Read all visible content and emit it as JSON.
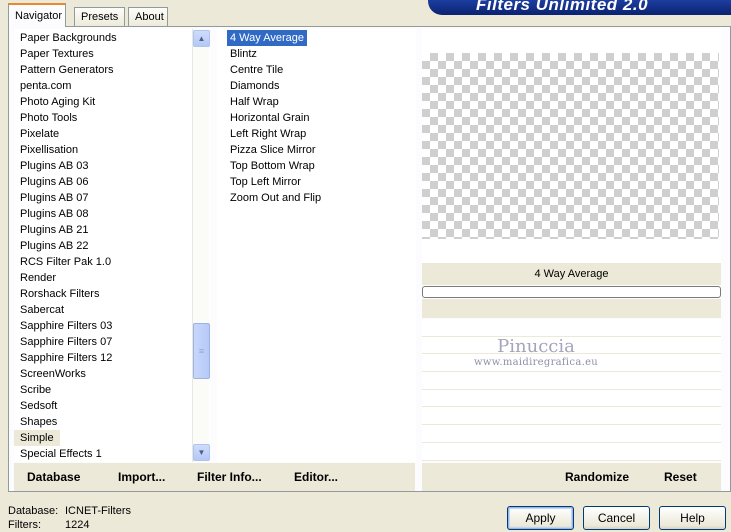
{
  "app": {
    "title": "Filters Unlimited 2.0"
  },
  "tabs": [
    {
      "label": "Navigator",
      "active": true
    },
    {
      "label": "Presets",
      "active": false
    },
    {
      "label": "About",
      "active": false
    }
  ],
  "categories": {
    "items": [
      "Paper Backgrounds",
      "Paper Textures",
      "Pattern Generators",
      "penta.com",
      "Photo Aging Kit",
      "Photo Tools",
      "Pixelate",
      "Pixellisation",
      "Plugins AB 03",
      "Plugins AB 06",
      "Plugins AB 07",
      "Plugins AB 08",
      "Plugins AB 21",
      "Plugins AB 22",
      "RCS Filter Pak 1.0",
      "Render",
      "Rorshack Filters",
      "Sabercat",
      "Sapphire Filters 03",
      "Sapphire Filters 07",
      "Sapphire Filters 12",
      "ScreenWorks",
      "Scribe",
      "Sedsoft",
      "Shapes",
      "Simple",
      "Special Effects 1"
    ],
    "selected": "Simple",
    "scroll_icons": {
      "up": "scroll-up-arrow-icon",
      "down": "scroll-down-arrow-icon",
      "thumb_grip": "grip-lines-icon"
    }
  },
  "filters": {
    "items": [
      "4 Way Average",
      "Blintz",
      "Centre Tile",
      "Diamonds",
      "Half Wrap",
      "Horizontal Grain",
      "Left Right Wrap",
      "Pizza Slice Mirror",
      "Top Bottom Wrap",
      "Top Left Mirror",
      "Zoom Out and Flip"
    ],
    "selected": "4 Way Average"
  },
  "preview": {
    "filter_name": "4 Way Average",
    "progress": 0.0
  },
  "watermark": {
    "name": "Pinuccia",
    "url": "www.maidiregrafica.eu"
  },
  "toolbar": {
    "database": "Database",
    "import": "Import...",
    "filter_info": "Filter Info...",
    "editor": "Editor...",
    "randomize": "Randomize",
    "reset": "Reset"
  },
  "status": {
    "database_label": "Database:",
    "database_value": "ICNET-Filters",
    "filters_label": "Filters:",
    "filters_value": "1224"
  },
  "buttons": {
    "apply": "Apply",
    "cancel": "Cancel",
    "help": "Help"
  },
  "colors": {
    "selection": "#316ac5",
    "banner": "#1d3ea0",
    "face": "#ece9d8"
  }
}
